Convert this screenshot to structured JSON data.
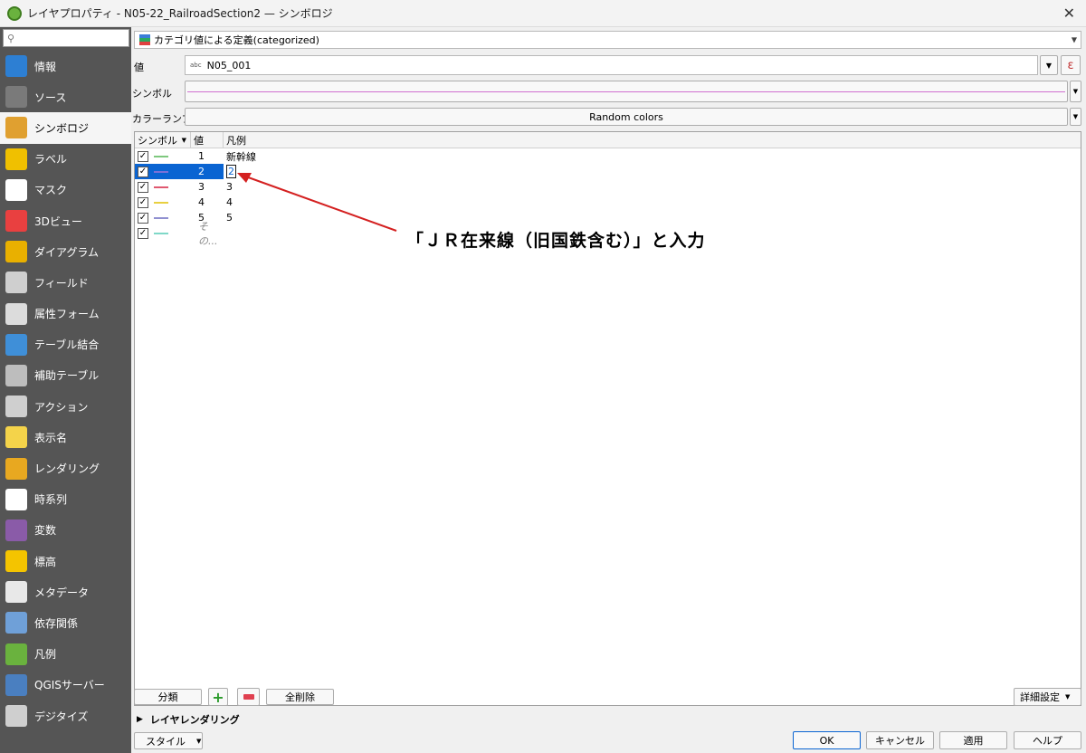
{
  "window": {
    "title": "レイヤプロパティ - N05-22_RailroadSection2 — シンボロジ"
  },
  "sidebar": {
    "items": [
      {
        "label": "情報",
        "icon": "info-icon",
        "color": "#2d7fd3"
      },
      {
        "label": "ソース",
        "icon": "source-icon",
        "color": "#7a7a7a"
      },
      {
        "label": "シンボロジ",
        "icon": "paintbrush-icon",
        "color": "#e0a030"
      },
      {
        "label": "ラベル",
        "icon": "label-abc-icon",
        "color": "#f0c000"
      },
      {
        "label": "マスク",
        "icon": "mask-abc-icon",
        "color": "#ffffff"
      },
      {
        "label": "3Dビュー",
        "icon": "cube-3d-icon",
        "color": "#e94040"
      },
      {
        "label": "ダイアグラム",
        "icon": "diagram-icon",
        "color": "#e9b000"
      },
      {
        "label": "フィールド",
        "icon": "fields-icon",
        "color": "#cfcfcf"
      },
      {
        "label": "属性フォーム",
        "icon": "form-icon",
        "color": "#dcdcdc"
      },
      {
        "label": "テーブル結合",
        "icon": "join-icon",
        "color": "#3f8fd8"
      },
      {
        "label": "補助テーブル",
        "icon": "aux-table-icon",
        "color": "#bdbdbd"
      },
      {
        "label": "アクション",
        "icon": "action-gear-icon",
        "color": "#cfcfcf"
      },
      {
        "label": "表示名",
        "icon": "display-name-icon",
        "color": "#f4d34a"
      },
      {
        "label": "レンダリング",
        "icon": "rendering-brush-icon",
        "color": "#e8a820"
      },
      {
        "label": "時系列",
        "icon": "clock-icon",
        "color": "#ffffff"
      },
      {
        "label": "変数",
        "icon": "variable-epsilon-icon",
        "color": "#8a5ba8"
      },
      {
        "label": "標高",
        "icon": "elevation-icon",
        "color": "#f4c400"
      },
      {
        "label": "メタデータ",
        "icon": "metadata-icon",
        "color": "#e8e8e8"
      },
      {
        "label": "依存関係",
        "icon": "dependency-icon",
        "color": "#6fa0d8"
      },
      {
        "label": "凡例",
        "icon": "legend-icon",
        "color": "#6ab23e"
      },
      {
        "label": "QGISサーバー",
        "icon": "server-icon",
        "color": "#4a7fc0"
      },
      {
        "label": "デジタイズ",
        "icon": "digitize-icon",
        "color": "#cfcfcf"
      }
    ],
    "active_index": 2
  },
  "renderer": {
    "label": "カテゴリ値による定義(categorized)"
  },
  "value": {
    "label": "値",
    "type_badge": "abc",
    "field": "N05_001",
    "expr": "ε"
  },
  "symbol": {
    "label": "シンボル",
    "color": "#d070d0"
  },
  "color_ramp": {
    "label": "カラーランプ",
    "value": "Random colors"
  },
  "table": {
    "headers": [
      "シンボル",
      "値",
      "凡例"
    ],
    "rows": [
      {
        "value": "1",
        "legend": "新幹線",
        "color": "#7ec87e"
      },
      {
        "value": "2",
        "legend": "2",
        "color": "#7a70d8"
      },
      {
        "value": "3",
        "legend": "3",
        "color": "#e05870"
      },
      {
        "value": "4",
        "legend": "4",
        "color": "#e8d040"
      },
      {
        "value": "5",
        "legend": "5",
        "color": "#9090d0"
      },
      {
        "value": "その...",
        "legend": "",
        "color": "#7fd8c8"
      }
    ]
  },
  "buttons": {
    "classify": "分類",
    "delete_all": "全削除",
    "advanced": "詳細設定",
    "layer_rendering": "レイヤレンダリング",
    "style": "スタイル",
    "ok": "OK",
    "cancel": "キャンセル",
    "apply": "適用",
    "help": "ヘルプ"
  },
  "annotation": {
    "text": "「ＪＲ在来線（旧国鉄含む）」と入力",
    "color": "#d42020"
  }
}
